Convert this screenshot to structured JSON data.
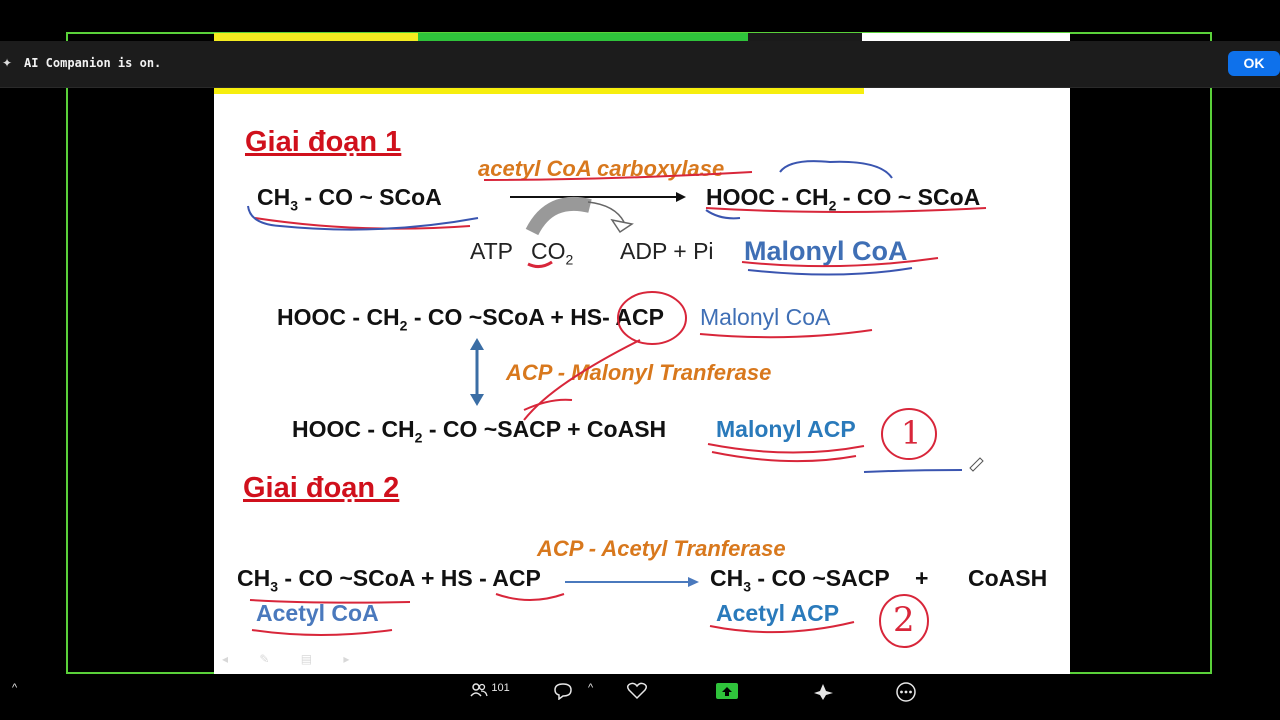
{
  "notification": {
    "icon": "sparkle-icon",
    "text": "AI Companion is on.",
    "ok_label": "OK"
  },
  "slide": {
    "stage1_heading": "Giai đoạn 1",
    "stage2_heading": "Giai đoạn 2",
    "enzyme_carboxylase": "acetyl CoA carboxylase",
    "acetyl_coa_formula": {
      "a": "CH",
      "sub": "3",
      "b": " - CO ~ SCoA"
    },
    "malonyl_coa_formula": {
      "a": "HOOC - CH",
      "sub": "2",
      "b": " - CO ~ SCoA"
    },
    "atp": "ATP",
    "co2": {
      "a": "CO",
      "sub": "2"
    },
    "adp_pi": "ADP + Pi",
    "malonyl_coa_label_1": "Malonyl CoA",
    "reaction2_left": {
      "a": "HOOC - CH",
      "sub": "2",
      "b": " - CO ~SCoA + HS- ACP"
    },
    "malonyl_coa_label_2": "Malonyl CoA",
    "enzyme_malonyl_transferase": "ACP - Malonyl Tranferase",
    "reaction2_right": {
      "a": "HOOC - CH",
      "sub": "2",
      "b": " - CO ~SACP + CoASH"
    },
    "malonyl_acp_label": "Malonyl ACP",
    "annotation_1": "1",
    "enzyme_acetyl_transferase": "ACP - Acetyl Tranferase",
    "reaction3_left": {
      "a": "CH",
      "sub": "3",
      "b": " - CO ~SCoA + HS - ACP"
    },
    "reaction3_right": {
      "a": "CH",
      "sub": "3",
      "b": " - CO ~SACP"
    },
    "plus": "+",
    "coash": "CoASH",
    "acetyl_coa_label": "Acetyl CoA",
    "acetyl_acp_label": "Acetyl ACP",
    "annotation_2": "2"
  },
  "toolbar": {
    "participants_icon": "participants-icon",
    "participants_count": "101",
    "chat_icon": "chat-icon",
    "react_icon": "heart-icon",
    "share_icon": "share-screen-icon",
    "ai_icon": "ai-companion-icon",
    "more_icon": "more-icon"
  },
  "colors": {
    "accent_green": "#5ad13a",
    "ok_blue": "#0e71eb",
    "heading_red": "#d0101c",
    "enzyme_orange": "#d8781d"
  }
}
